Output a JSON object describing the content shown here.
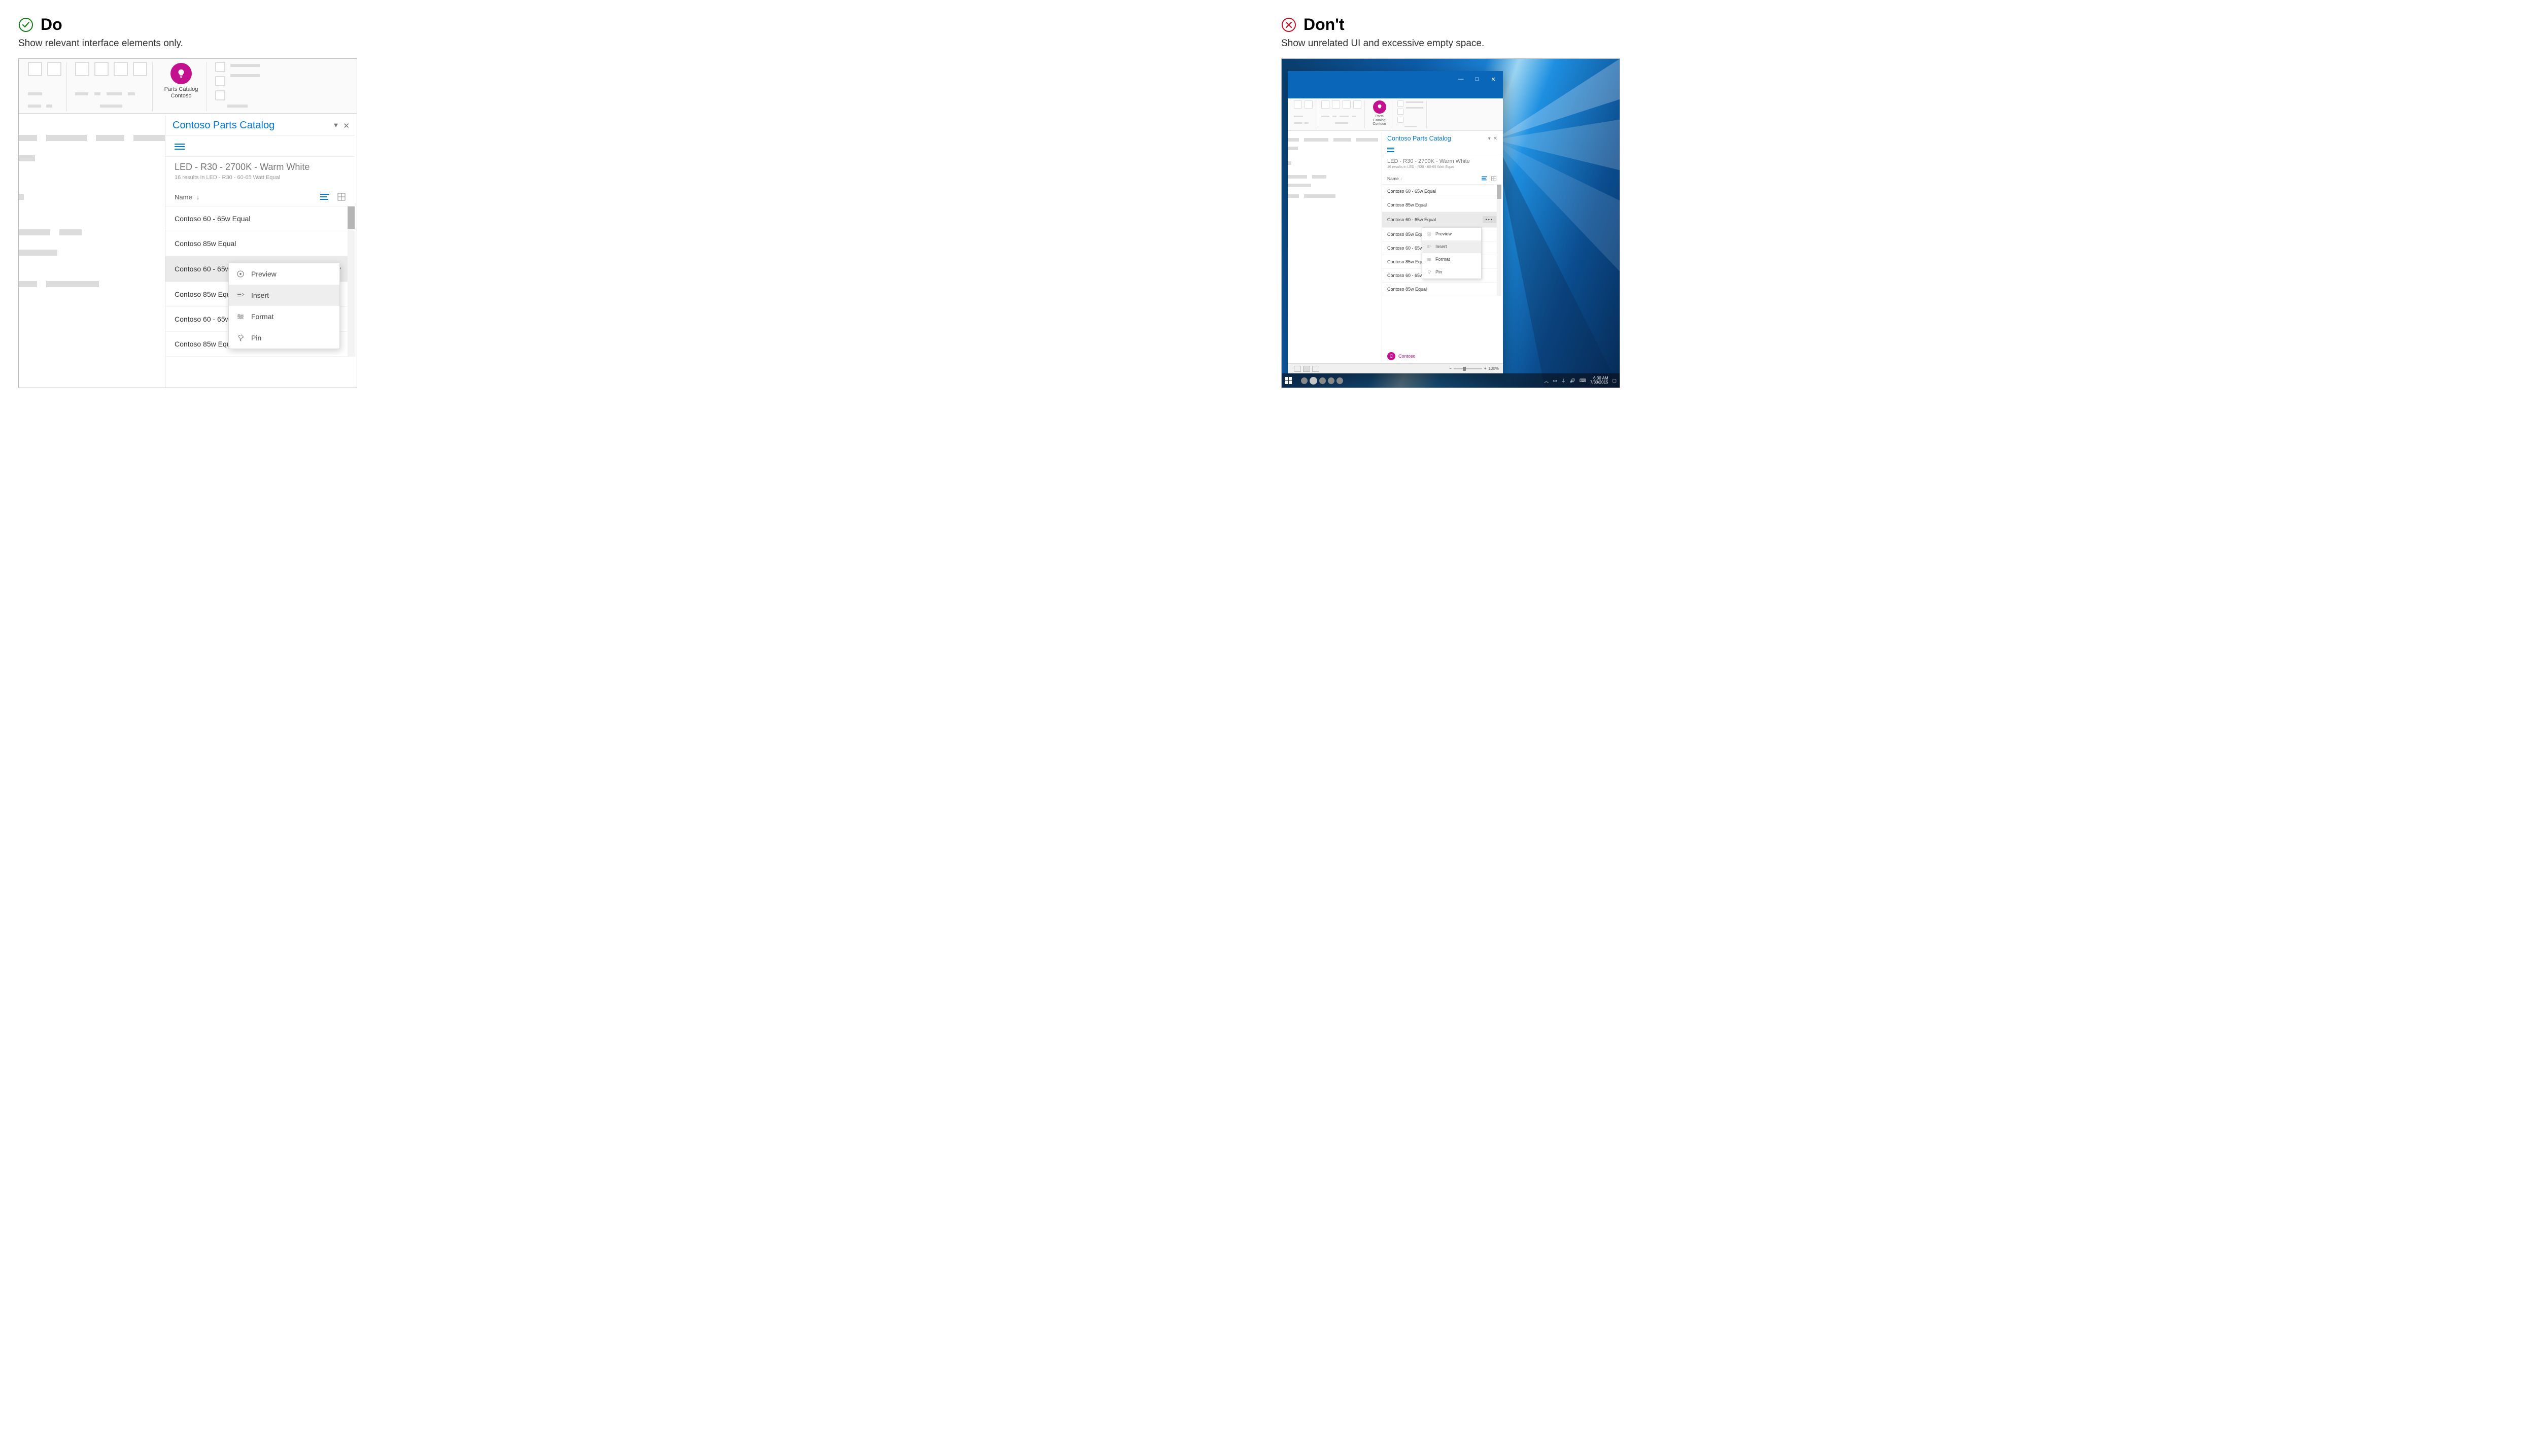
{
  "do": {
    "title": "Do",
    "subtitle": "Show relevant interface elements only."
  },
  "dont": {
    "title": "Don't",
    "subtitle": "Show unrelated UI and excessive empty space."
  },
  "ribbon": {
    "catalog_line1": "Parts Catalog",
    "catalog_line2": "Contoso"
  },
  "taskpane": {
    "title": "Contoso Parts Catalog",
    "breadcrumb_title": "LED - R30 - 2700K - Warm White",
    "breadcrumb_sub": "16 results in LED - R30 - 60-65 Watt Equal",
    "sort_label": "Name",
    "items": [
      "Contoso 60 - 65w Equal",
      "Contoso 85w Equal",
      "Contoso 60 - 65w Equal",
      "Contoso 85w Equal",
      "Contoso 60 - 65w Equal",
      "Contoso 85w Equal",
      "Contoso 60 - 65w Equal",
      "Contoso 85w Equal"
    ],
    "items_do_selected_index": 2,
    "brand": "Contoso"
  },
  "context_menu": {
    "items": [
      "Preview",
      "Insert",
      "Format",
      "Pin"
    ],
    "hover_index": 1
  },
  "statusbar": {
    "zoom": "100%"
  },
  "taskbar": {
    "time": "6:30 AM",
    "date": "7/30/2015"
  }
}
